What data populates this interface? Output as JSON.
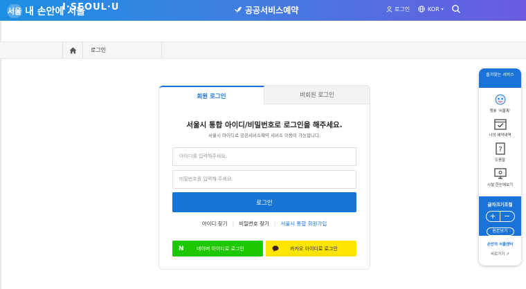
{
  "colors": {
    "header_start": "#1c8fe3",
    "header_end": "#6a5be0",
    "accent": "#1574d4",
    "naver": "#1ec800",
    "kakao": "#fee500"
  },
  "header": {
    "logo_mark": "서울",
    "logo_text": "내 손안에 서울",
    "brand": "I·SEOUL·U",
    "site_title": "공공서비스예약",
    "login": "로그인",
    "lang": "KOR",
    "icons": [
      "sprout-icon",
      "user-icon",
      "globe-icon",
      "search-icon"
    ]
  },
  "breadcrumb": {
    "current": "로그인",
    "home_icon": "home-icon"
  },
  "login": {
    "tabs": [
      "회원 로그인",
      "비회원 로그인"
    ],
    "title": "서울시 통합 아이디/비밀번호로 로그인을 해주세요.",
    "subtitle": "서울시 아이디로 공공서비스예약 서비스 이용이 가능합니다.",
    "id_placeholder": "아이디를 입력해주세요.",
    "pw_placeholder": "비밀번호를 입력해 주세요.",
    "login_button": "로그인",
    "links": [
      "아이디 찾기",
      "비밀번호 찾기",
      "서울시 통합 회원가입"
    ],
    "naver_button": "네이버 아이디로 로그인",
    "naver_icon_glyph": "N",
    "kakao_button": "카카오 아이디로 로그인"
  },
  "quick_menu": {
    "title": "즐겨찾는 서비스",
    "items": [
      "챗봇 '서울톡'",
      "나의 예약내역",
      "도움말",
      "시설 한눈에보기"
    ],
    "fontsize_title": "글자크기조절",
    "plus": "+",
    "minus": "−",
    "reset": "원본보기",
    "sonan_logo": "손안의 서울센터",
    "shortcut": "바로가기 ↗"
  }
}
